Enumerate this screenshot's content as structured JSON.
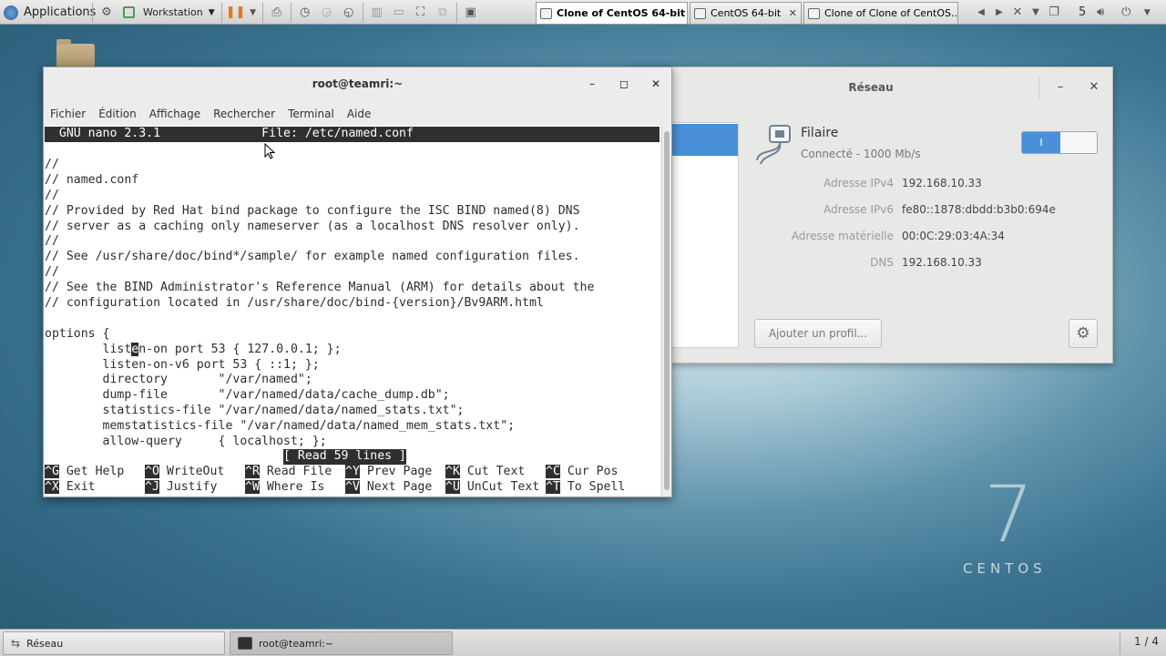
{
  "topbar": {
    "applications_label": "Applications",
    "workstation_label": "Workstation",
    "tabs": [
      {
        "label": "Clone of CentOS 64-bit",
        "active": true
      },
      {
        "label": "CentOS 64-bit",
        "active": false
      },
      {
        "label": "Clone of Clone of CentOS...",
        "active": false
      }
    ],
    "tray_number": "5",
    "icons": [
      "gear-icon",
      "vm-icon",
      "pause-icon",
      "send-keys-icon",
      "snapshot-icon",
      "revert-icon",
      "manage-snapshots-icon",
      "sidebar-icon",
      "console-icon",
      "fullscreen-icon",
      "unity-icon",
      "home-icon",
      "volume-icon",
      "power-icon"
    ]
  },
  "desktop": {
    "centos_version": "7",
    "centos_word": "CENTOS"
  },
  "network": {
    "title": "Réseau",
    "connection_name": "Filaire",
    "connection_status": "Connecté - 1000 Mb/s",
    "toggle_label": "I",
    "details": [
      {
        "label": "Adresse IPv4",
        "value": "192.168.10.33"
      },
      {
        "label": "Adresse IPv6",
        "value": "fe80::1878:dbdd:b3b0:694e"
      },
      {
        "label": "Adresse matérielle",
        "value": "00:0C:29:03:4A:34"
      },
      {
        "label": "DNS",
        "value": "192.168.10.33"
      }
    ],
    "add_profile_label": "Ajouter un profil...",
    "colors": {
      "accent": "#4a90d9"
    }
  },
  "terminal": {
    "title": "root@teamri:~",
    "menu": [
      "Fichier",
      "Édition",
      "Affichage",
      "Rechercher",
      "Terminal",
      "Aide"
    ],
    "nano_header": "  GNU nano 2.3.1              File: /etc/named.conf                          ",
    "lines": [
      "//",
      "// named.conf",
      "//",
      "// Provided by Red Hat bind package to configure the ISC BIND named(8) DNS",
      "// server as a caching only nameserver (as a localhost DNS resolver only).",
      "//",
      "// See /usr/share/doc/bind*/sample/ for example named configuration files.",
      "//",
      "// See the BIND Administrator's Reference Manual (ARM) for details about the",
      "// configuration located in /usr/share/doc/bind-{version}/Bv9ARM.html",
      "",
      "options {",
      "        listen-on port 53 { 127.0.0.1; };",
      "        listen-on-v6 port 53 { ::1; };",
      "        directory       \"/var/named\";",
      "        dump-file       \"/var/named/data/cache_dump.db\";",
      "        statistics-file \"/var/named/data/named_stats.txt\";",
      "        memstatistics-file \"/var/named/data/named_mem_stats.txt\";",
      "        allow-query     { localhost; };"
    ],
    "status_message": "[ Read 59 lines ]",
    "shortcuts": [
      [
        {
          "key": "^G",
          "label": " Get Help"
        },
        {
          "key": "^O",
          "label": " WriteOut"
        },
        {
          "key": "^R",
          "label": " Read File"
        },
        {
          "key": "^Y",
          "label": " Prev Page"
        },
        {
          "key": "^K",
          "label": " Cut Text"
        },
        {
          "key": "^C",
          "label": " Cur Pos"
        }
      ],
      [
        {
          "key": "^X",
          "label": " Exit"
        },
        {
          "key": "^J",
          "label": " Justify"
        },
        {
          "key": "^W",
          "label": " Where Is"
        },
        {
          "key": "^V",
          "label": " Next Page"
        },
        {
          "key": "^U",
          "label": " UnCut Text"
        },
        {
          "key": "^T",
          "label": " To Spell"
        }
      ]
    ]
  },
  "taskbar": {
    "items": [
      {
        "label": "Réseau",
        "active": false
      },
      {
        "label": "root@teamri:~",
        "active": true
      }
    ],
    "pager": "1 / 4"
  }
}
